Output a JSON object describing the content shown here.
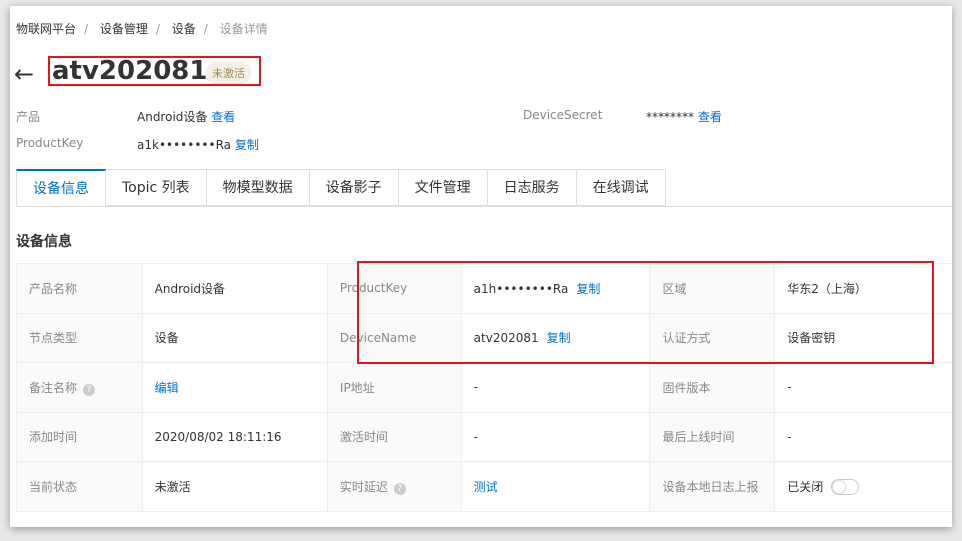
{
  "breadcrumb": [
    "物联网平台",
    "设备管理",
    "设备",
    "设备详情"
  ],
  "device": {
    "name": "atv202081",
    "status": "未激活"
  },
  "meta": {
    "product_label": "产品",
    "product_value": "Android设备",
    "product_link": "查看",
    "pk_label": "ProductKey",
    "pk_value": "a1k••••••••Ra",
    "pk_link": "复制",
    "secret_label": "DeviceSecret",
    "secret_value": "********",
    "secret_link": "查看"
  },
  "tabs": [
    "设备信息",
    "Topic 列表",
    "物模型数据",
    "设备影子",
    "文件管理",
    "日志服务",
    "在线调试"
  ],
  "section_title": "设备信息",
  "rows": [
    [
      {
        "l": "产品名称",
        "v": "Android设备"
      },
      {
        "l": "ProductKey",
        "v": "a1h••••••••Ra",
        "link": "复制"
      },
      {
        "l": "区域",
        "v": "华东2（上海）"
      }
    ],
    [
      {
        "l": "节点类型",
        "v": "设备"
      },
      {
        "l": "DeviceName",
        "v": "atv202081",
        "link": "复制"
      },
      {
        "l": "认证方式",
        "v": "设备密钥"
      }
    ],
    [
      {
        "l": "备注名称",
        "link": "编辑"
      },
      {
        "l": "IP地址",
        "v": "-"
      },
      {
        "l": "固件版本",
        "v": "-"
      }
    ],
    [
      {
        "l": "添加时间",
        "v": "2020/08/02 18:11:16"
      },
      {
        "l": "激活时间",
        "v": "-"
      },
      {
        "l": "最后上线时间",
        "v": "-"
      }
    ],
    [
      {
        "l": "当前状态",
        "v": "未激活"
      },
      {
        "l": "实时延迟",
        "link": "测试"
      },
      {
        "l": "设备本地日志上报",
        "v": "已关闭"
      }
    ]
  ],
  "help_glyph": "?"
}
